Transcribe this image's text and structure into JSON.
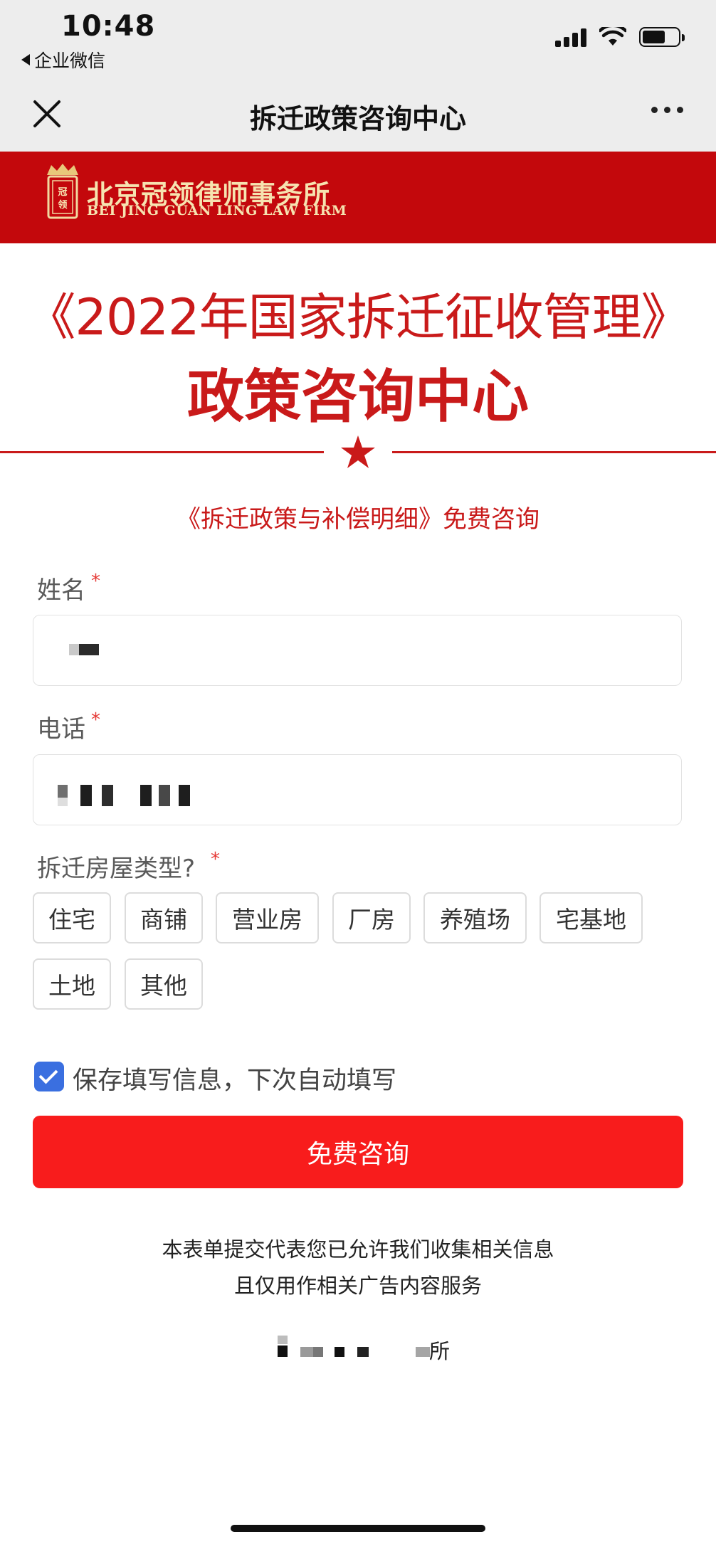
{
  "status_bar": {
    "time": "10:48",
    "back_app": "企业微信",
    "icons": [
      "signal-icon",
      "wifi-icon",
      "battery-icon"
    ]
  },
  "nav": {
    "title": "拆迁政策咨询中心",
    "close_icon": "close-icon",
    "more_icon": "more-icon"
  },
  "brand": {
    "name_cn": "北京冠领律师事务所",
    "name_en": "BEI JING GUAN LING LAW FIRM",
    "emblem_text": "冠领",
    "bar_color": "#c3080c"
  },
  "headline": {
    "line1": "《2022年国家拆迁征收管理》",
    "line2": "政策咨询中心",
    "sub": "《拆迁政策与补偿明细》免费咨询",
    "color": "#c91a1a"
  },
  "form": {
    "name_label": "姓名",
    "phone_label": "电话",
    "required_mark": "*",
    "house_type_label": "拆迁房屋类型?",
    "house_types": [
      "住宅",
      "商铺",
      "营业房",
      "厂房",
      "养殖场",
      "宅基地",
      "土地",
      "其他"
    ],
    "save_info_label": "保存填写信息，下次自动填写",
    "save_info_checked": true,
    "submit_label": "免费咨询",
    "submit_color": "#f81c1c"
  },
  "notice": {
    "line1": "本表单提交代表您已允许我们收集相关信息",
    "line2": "且仅用作相关广告内容服务"
  },
  "footer": {
    "visible_suffix": "所"
  }
}
